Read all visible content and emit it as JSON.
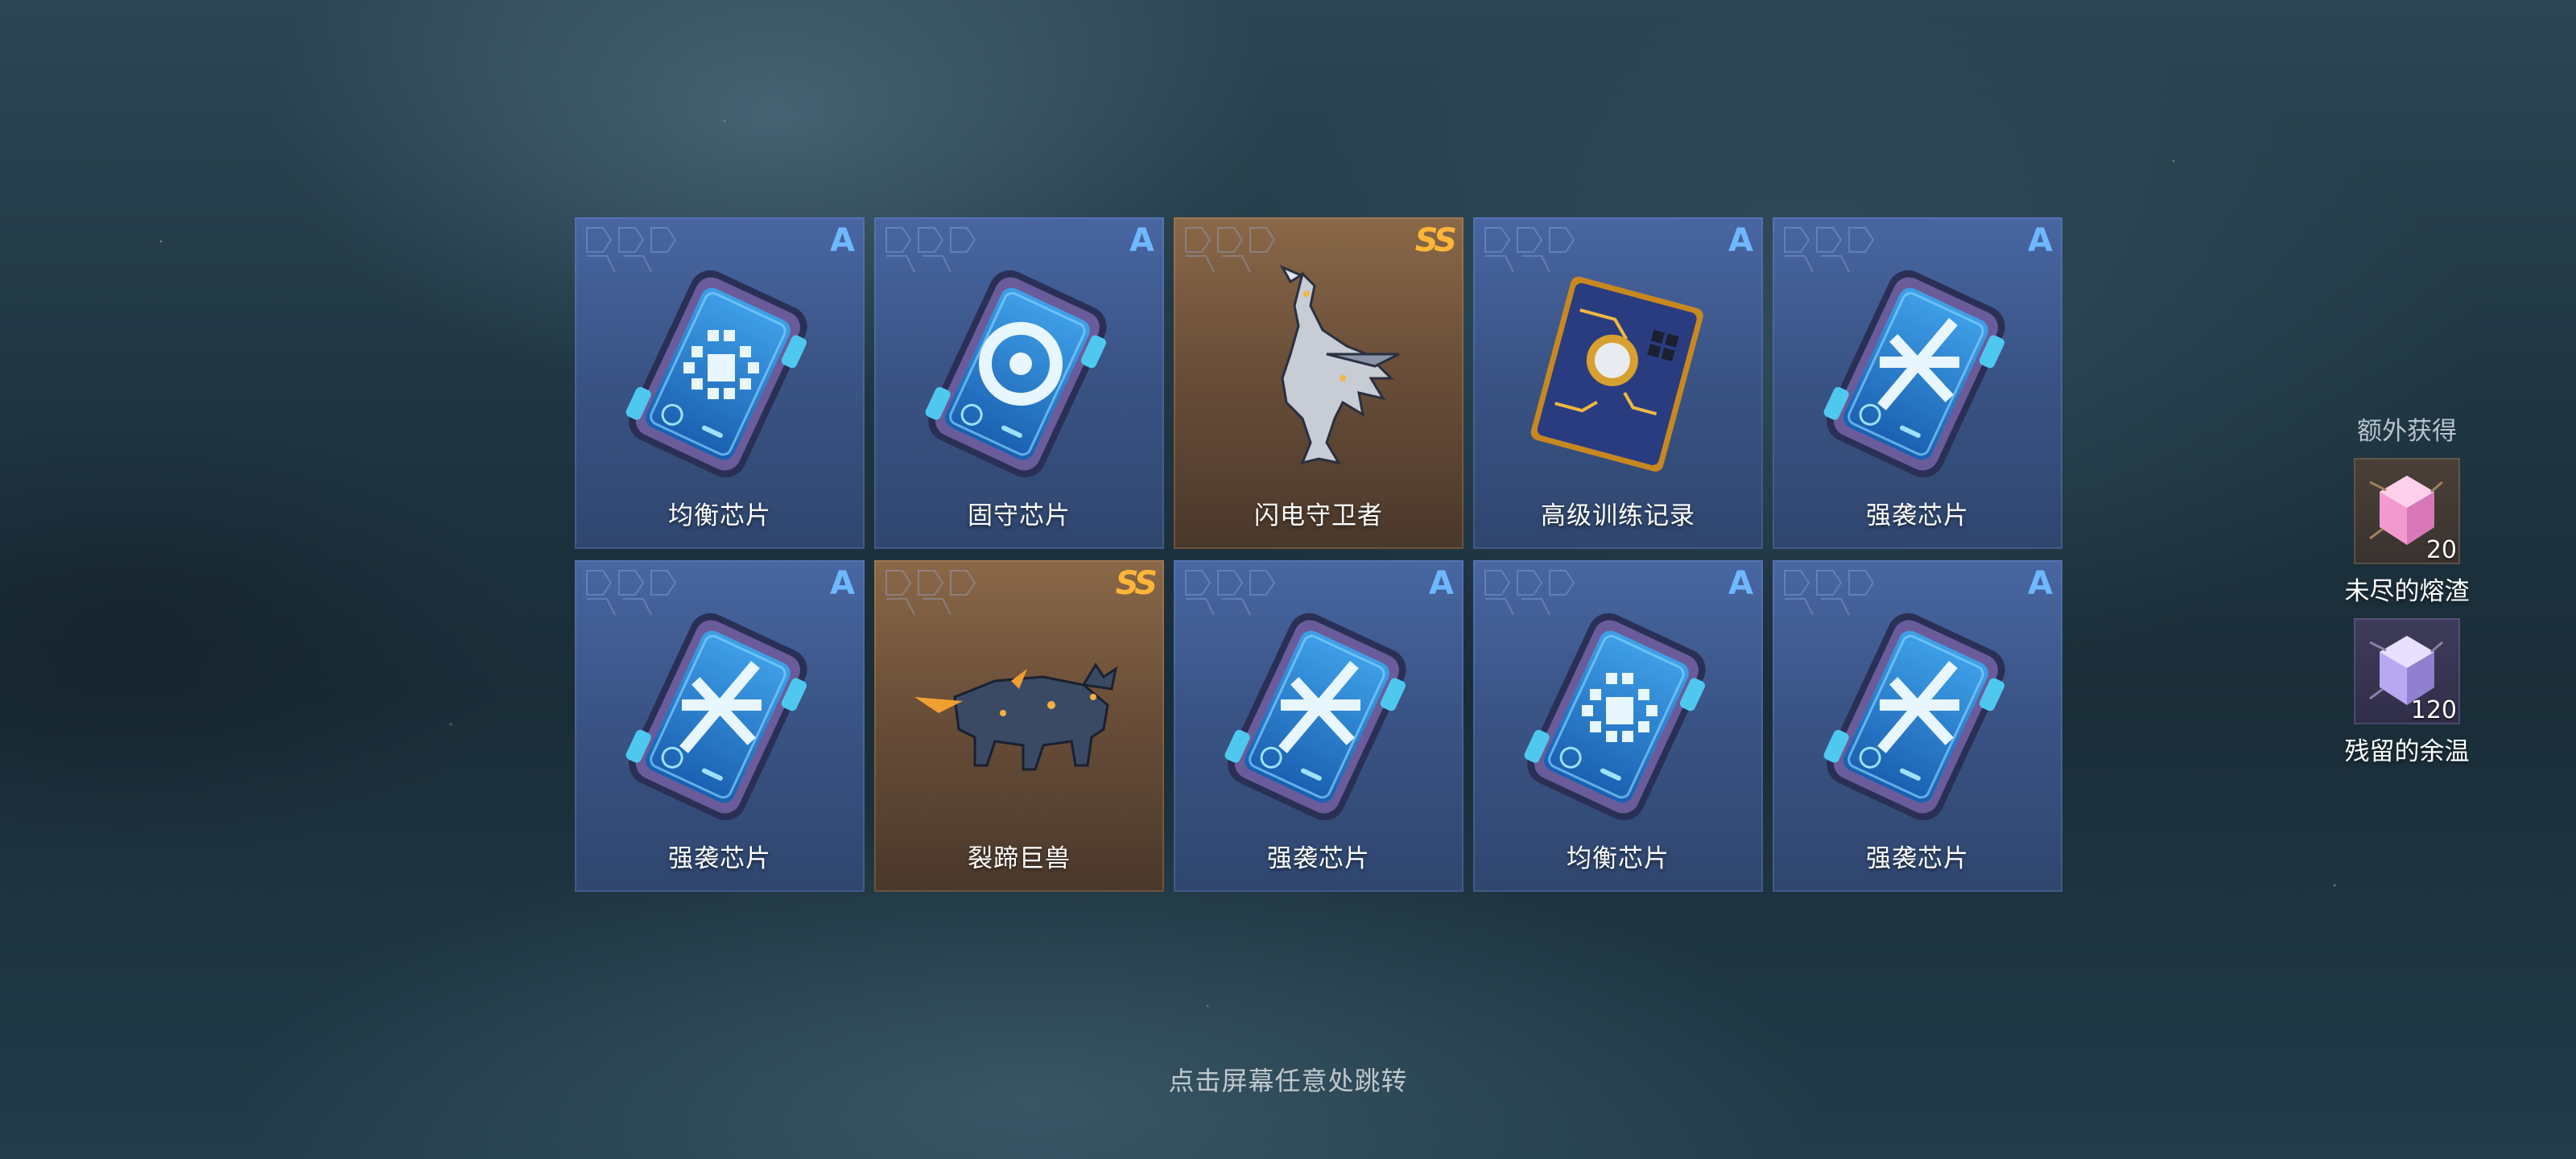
{
  "rewards": [
    {
      "name": "均衡芯片",
      "rank": "A",
      "icon": "balance-chip-icon"
    },
    {
      "name": "固守芯片",
      "rank": "A",
      "icon": "guard-chip-icon"
    },
    {
      "name": "闪电守卫者",
      "rank": "SS",
      "icon": "mecha-bird-icon"
    },
    {
      "name": "高级训练记录",
      "rank": "A",
      "icon": "training-record-icon"
    },
    {
      "name": "强袭芯片",
      "rank": "A",
      "icon": "assault-chip-icon"
    },
    {
      "name": "强袭芯片",
      "rank": "A",
      "icon": "assault-chip-icon"
    },
    {
      "name": "裂蹄巨兽",
      "rank": "SS",
      "icon": "mecha-beast-icon"
    },
    {
      "name": "强袭芯片",
      "rank": "A",
      "icon": "assault-chip-icon"
    },
    {
      "name": "均衡芯片",
      "rank": "A",
      "icon": "balance-chip-icon"
    },
    {
      "name": "强袭芯片",
      "rank": "A",
      "icon": "assault-chip-icon"
    }
  ],
  "bonus": {
    "title": "额外获得",
    "items": [
      {
        "name": "未尽的熔渣",
        "qty": "20",
        "icon": "pink-crystal-icon"
      },
      {
        "name": "残留的余温",
        "qty": "120",
        "icon": "purple-crystal-icon"
      }
    ]
  },
  "hint": "点击屏幕任意处跳转",
  "colors": {
    "rank_a": "#6fb8ff",
    "rank_ss": "#ffb637",
    "card_a": "#3a5486",
    "card_ss": "#6a4e38"
  }
}
